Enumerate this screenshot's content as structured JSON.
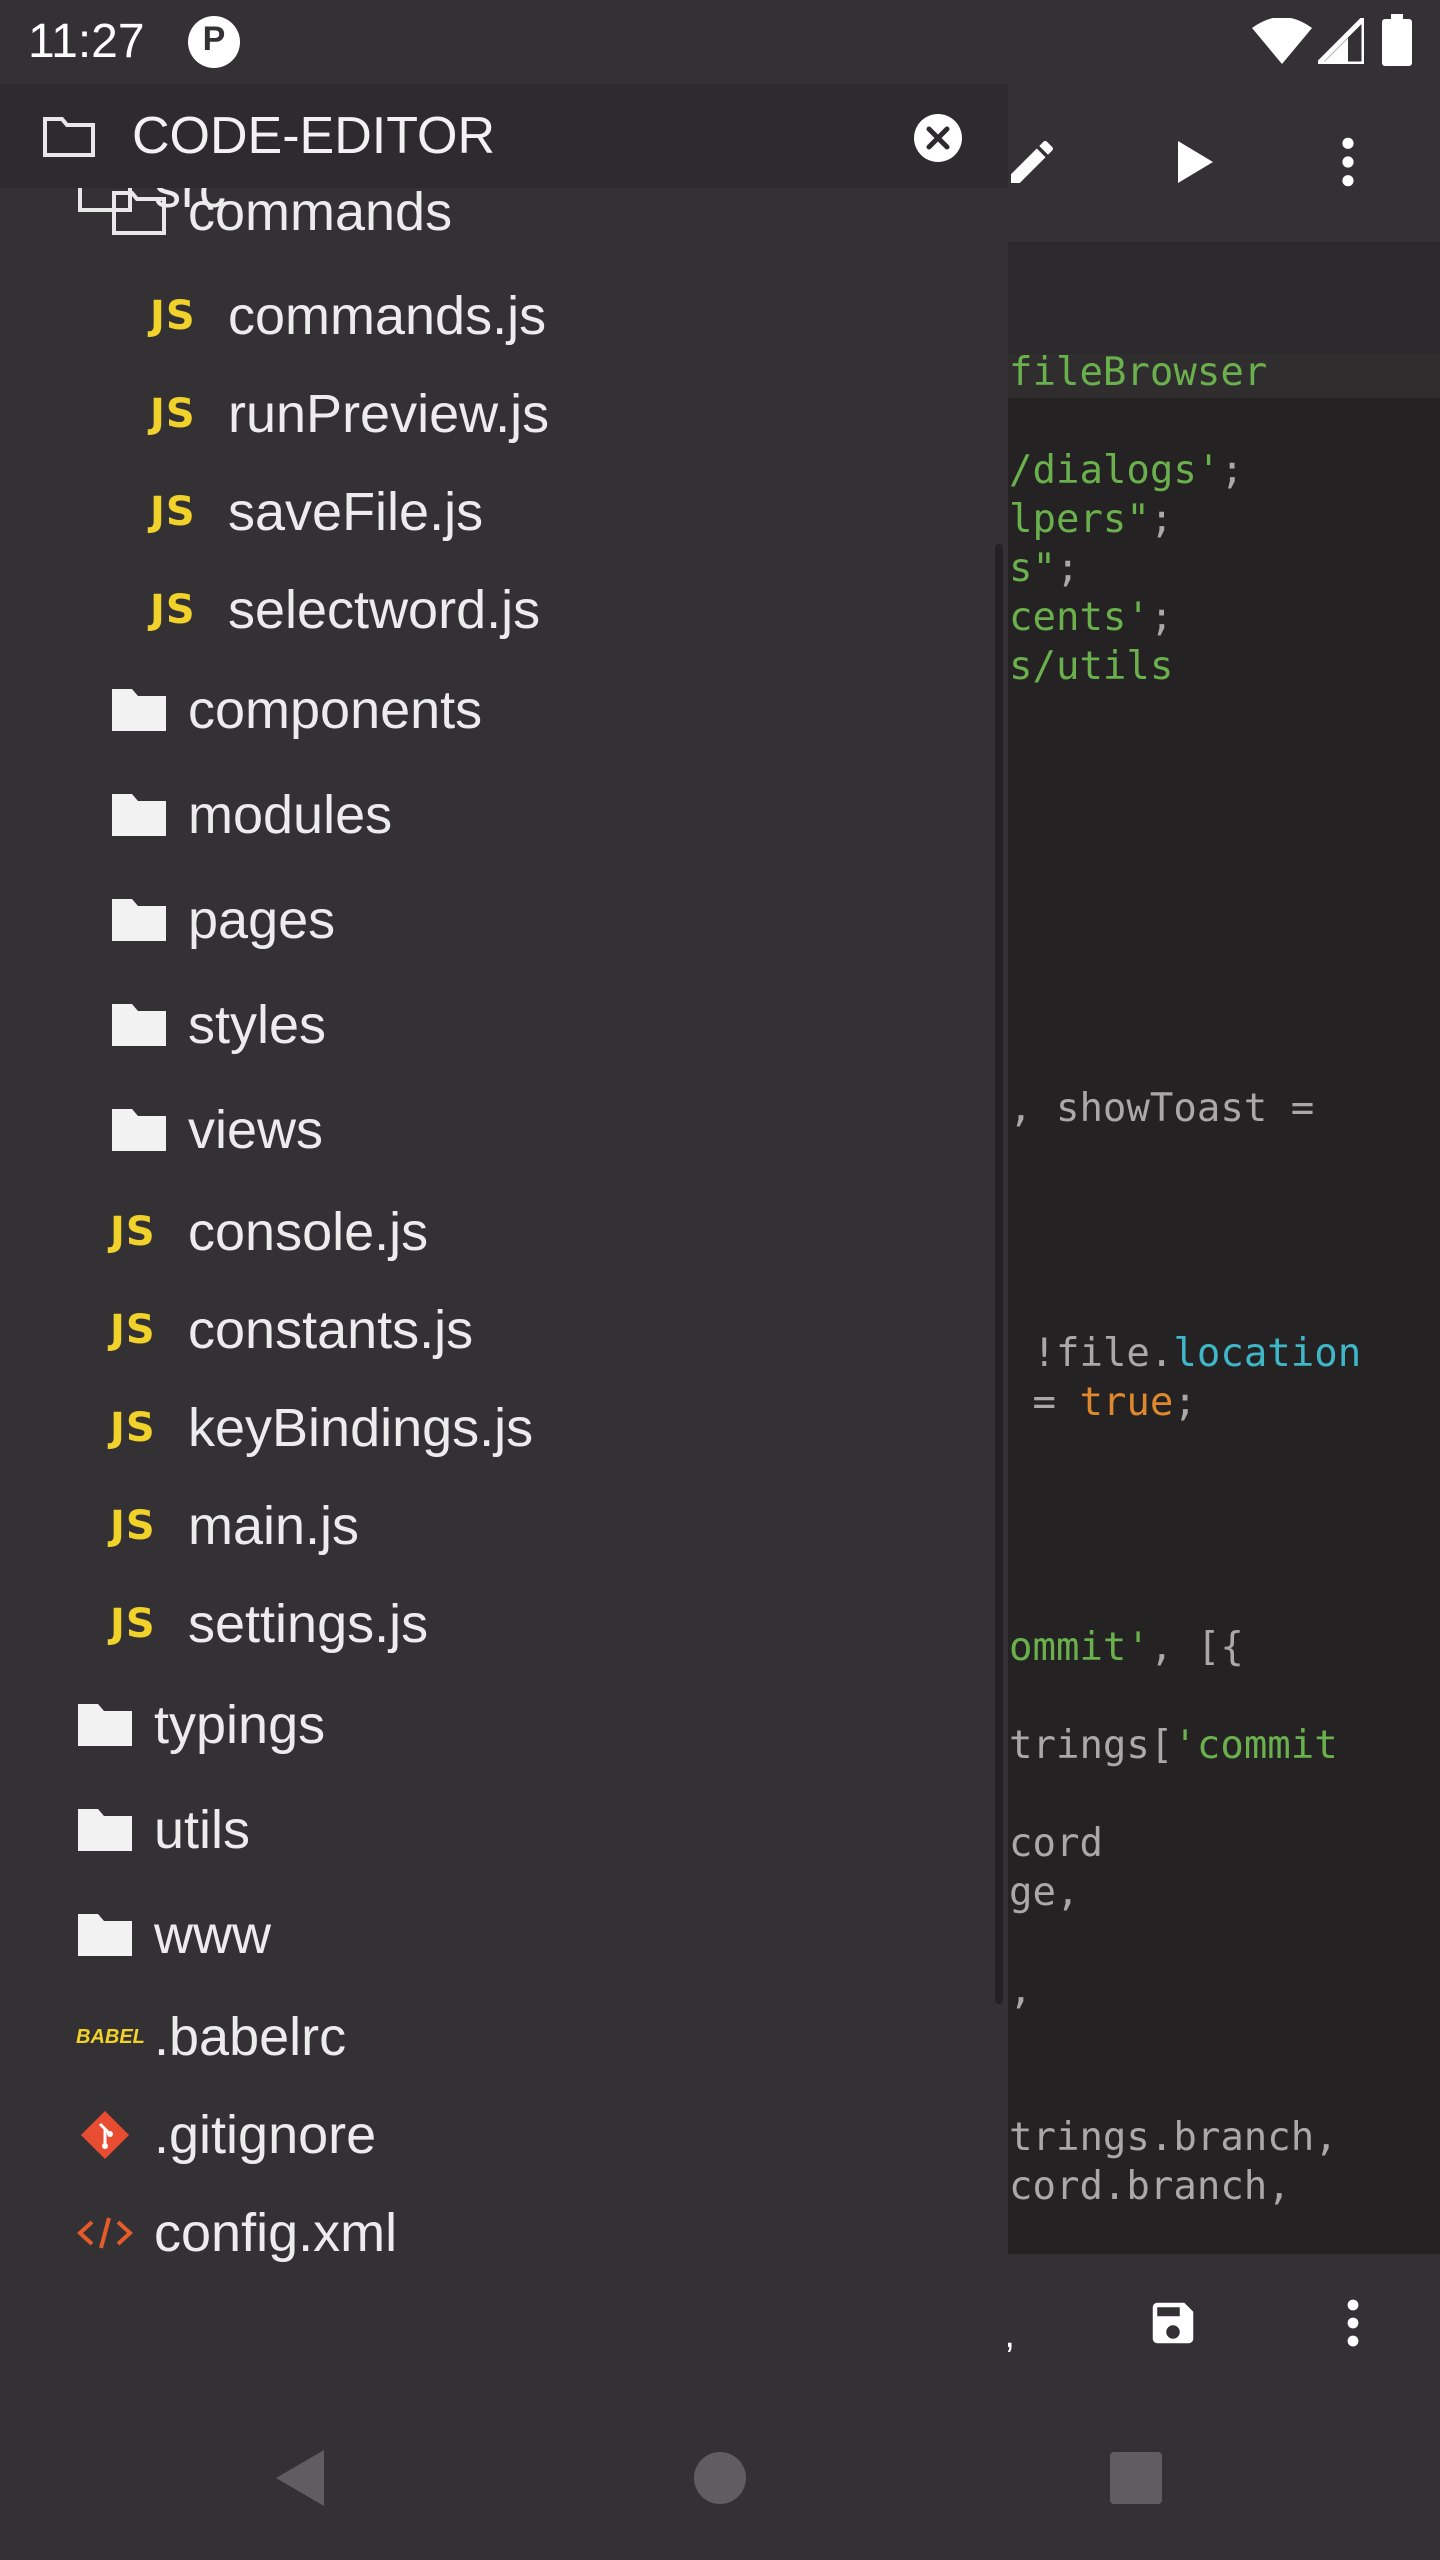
{
  "status_bar": {
    "time": "11:27",
    "notification_icon": "p-notification-icon",
    "wifi_icon": "wifi-icon",
    "signal_icon": "signal-icon",
    "battery_icon": "battery-icon"
  },
  "drawer": {
    "title": "CODE-EDITOR",
    "close_icon": "close-circle-icon",
    "partial_root": "src",
    "items": [
      {
        "label": "commands",
        "type": "folder-open"
      },
      {
        "label": "commands.js",
        "type": "js"
      },
      {
        "label": "runPreview.js",
        "type": "js"
      },
      {
        "label": "saveFile.js",
        "type": "js"
      },
      {
        "label": "selectword.js",
        "type": "js"
      },
      {
        "label": "components",
        "type": "folder"
      },
      {
        "label": "modules",
        "type": "folder"
      },
      {
        "label": "pages",
        "type": "folder"
      },
      {
        "label": "styles",
        "type": "folder"
      },
      {
        "label": "views",
        "type": "folder"
      },
      {
        "label": "console.js",
        "type": "js"
      },
      {
        "label": "constants.js",
        "type": "js"
      },
      {
        "label": "keyBindings.js",
        "type": "js"
      },
      {
        "label": "main.js",
        "type": "js"
      },
      {
        "label": "settings.js",
        "type": "js"
      },
      {
        "label": "typings",
        "type": "folder"
      },
      {
        "label": "utils",
        "type": "folder"
      },
      {
        "label": "www",
        "type": "folder"
      },
      {
        "label": ".babelrc",
        "type": "babel"
      },
      {
        "label": ".gitignore",
        "type": "git"
      },
      {
        "label": "config.xml",
        "type": "xml"
      }
    ],
    "js_badge": "JS",
    "babel_badge": "BABEL"
  },
  "editor": {
    "toolbar_icons": [
      "pencil-icon",
      "play-icon",
      "more-vertical-icon"
    ],
    "code_lines": [
      {
        "parts": [
          {
            "t": "fileBrowser",
            "c": "g"
          }
        ]
      },
      {
        "parts": [
          {
            "t": "/dialogs'",
            "c": "g"
          },
          {
            "t": ";",
            "c": "w"
          }
        ]
      },
      {
        "parts": [
          {
            "t": "lpers\"",
            "c": "g"
          },
          {
            "t": ";",
            "c": "w"
          }
        ]
      },
      {
        "parts": [
          {
            "t": "s\"",
            "c": "g"
          },
          {
            "t": ";",
            "c": "w"
          }
        ]
      },
      {
        "parts": [
          {
            "t": "cents'",
            "c": "g"
          },
          {
            "t": ";",
            "c": "w"
          }
        ]
      },
      {
        "parts": [
          {
            "t": "s/utils",
            "c": "g"
          }
        ]
      },
      {
        "parts": [
          {
            "t": ", showToast =",
            "c": "w"
          }
        ]
      },
      {
        "parts": [
          {
            "t": " !file.",
            "c": "w"
          },
          {
            "t": "location",
            "c": "b"
          }
        ]
      },
      {
        "parts": [
          {
            "t": " = ",
            "c": "w"
          },
          {
            "t": "true",
            "c": "o"
          },
          {
            "t": ";",
            "c": "w"
          }
        ]
      },
      {
        "parts": [
          {
            "t": "ommit'",
            "c": "g"
          },
          {
            "t": ", [{",
            "c": "w"
          }
        ]
      },
      {
        "parts": [
          {
            "t": "trings[",
            "c": "w"
          },
          {
            "t": "'commit",
            "c": "g"
          }
        ]
      },
      {
        "parts": [
          {
            "t": "cord",
            "c": "w"
          }
        ]
      },
      {
        "parts": [
          {
            "t": "ge,",
            "c": "w"
          }
        ]
      },
      {
        "parts": [
          {
            "t": ",",
            "c": "w"
          }
        ]
      },
      {
        "parts": [
          {
            "t": "trings.branch,",
            "c": "w"
          }
        ]
      },
      {
        "parts": [
          {
            "t": "cord.branch,",
            "c": "w"
          }
        ]
      }
    ],
    "bottom_icons": [
      "save-icon",
      "more-vertical-icon"
    ]
  },
  "nav_bar": {
    "icons": [
      "back-icon",
      "home-icon",
      "recents-icon"
    ]
  },
  "colors": {
    "drawer_bg": "#333134",
    "js_yellow": "#f1d22a",
    "code_green": "#6ab04c",
    "code_blue": "#3fb7c8",
    "code_orange": "#e0882d",
    "git_red": "#e84d31",
    "xml_orange": "#e55b2a"
  }
}
